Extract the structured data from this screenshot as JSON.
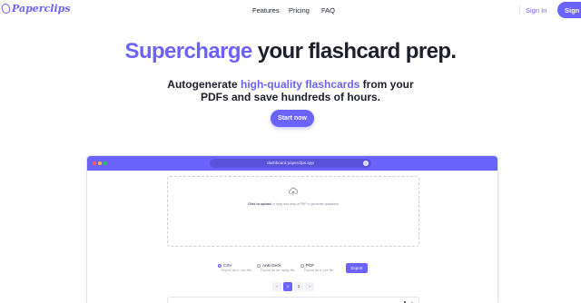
{
  "nav": {
    "brand": "Paperclips",
    "links": [
      "Features",
      "Pricing",
      "FAQ"
    ],
    "signin": "Sign In",
    "signup": "Sign Up"
  },
  "hero": {
    "headline_accent": "Supercharge",
    "headline_rest": " your flashcard prep.",
    "sub_line1_pre": "Autogenerate ",
    "sub_line1_accent": "high-quality flashcards",
    "sub_line1_post": " from your",
    "sub_line2": "PDFs and save hundreds of hours.",
    "cta": "Start now"
  },
  "browser": {
    "url": "dashboard.paperclips.app",
    "drop_text_bold": "Click to upload",
    "drop_text_rest": " or drag and drop a PDF to generate questions",
    "options": [
      {
        "label": "CSV",
        "desc": "Export as a .csv file",
        "checked": true
      },
      {
        "label": "Anki Deck",
        "desc": "Export as an .apkg file",
        "checked": false
      },
      {
        "label": "PDF",
        "desc": "Export as a .pdf file",
        "checked": false
      }
    ],
    "export_label": "Export",
    "pages": [
      "‹",
      "1",
      "2",
      "›"
    ],
    "active_page": "1"
  },
  "colors": {
    "accent": "#6c63ff"
  }
}
